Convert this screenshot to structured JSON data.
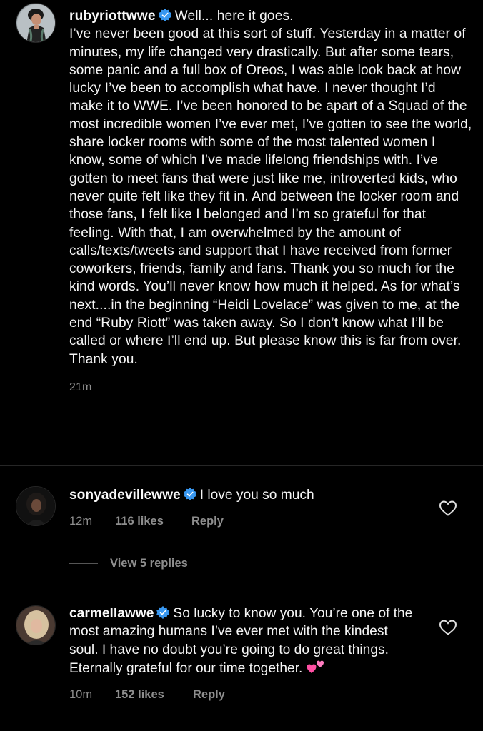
{
  "post": {
    "author": "rubyriottwwe",
    "title_text": "Well... here it goes.",
    "paragraph": "I’ve never been good at this sort of stuff.  Yesterday in a matter of minutes, my life changed very drastically. But after some tears, some panic and a full box of Oreos, I was able look back at how lucky I’ve been to accomplish what have. I never thought I’d make it to WWE. I’ve been honored to be apart of a Squad of the most incredible women I’ve ever met, I’ve gotten to see the world, share locker rooms with some of the most talented women I know, some of which I’ve made lifelong friendships with. I’ve gotten to meet fans that were just like me, introverted kids, who never quite felt like they fit in. And between the locker room and those fans, I felt like I belonged and I’m so grateful for that feeling. With that, I am overwhelmed by the amount of calls/texts/tweets and support that I have received from former coworkers, friends, family and fans. Thank you so much for the kind words. You’ll never know how much it helped. As for what’s next....in the beginning “Heidi Lovelace” was given to me, at the end “Ruby Riott” was taken away. So I don’t know what I’ll be called or where I’ll end up. But please know this is far from over. Thank you.",
    "time": "21m"
  },
  "comments": [
    {
      "author": "sonyadevillewwe",
      "text": "I love you so much",
      "time": "12m",
      "likes": "116 likes",
      "reply_label": "Reply"
    },
    {
      "author": "carmellawwe",
      "text": "So lucky to know you. You’re one of the most amazing humans I’ve ever met with the kindest soul. I have no doubt you’re going to do great things. Eternally grateful for our time together.",
      "time": "10m",
      "likes": "152 likes",
      "reply_label": "Reply"
    }
  ],
  "view_replies_label": "View 5 replies",
  "colors": {
    "background": "#000000",
    "text": "#f5f5f5",
    "secondary": "#8e8e8e",
    "verified": "#3897f0",
    "emoji_pink": "#ff4fa3"
  },
  "icons": [
    "verified-badge-icon",
    "heart-outline-icon",
    "two-hearts-emoji-icon"
  ]
}
